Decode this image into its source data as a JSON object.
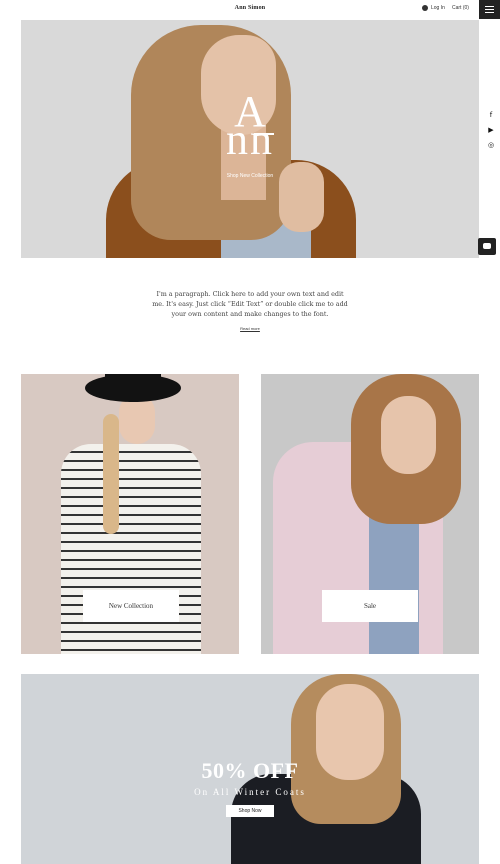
{
  "header": {
    "site_title": "Ann Simon",
    "login_label": "Log In",
    "cart_label": "Cart (0)"
  },
  "icons": {
    "menu": "hamburger-icon",
    "user": "user-icon",
    "facebook": "facebook-icon",
    "youtube": "youtube-icon",
    "instagram": "instagram-icon",
    "chat": "chat-icon"
  },
  "social": {
    "facebook_glyph": "f",
    "youtube_glyph": "▶",
    "instagram_glyph": "◎"
  },
  "hero": {
    "logo_line1": "A",
    "logo_line2": "nn",
    "cta": "Shop New Collection"
  },
  "intro": {
    "paragraph": "I'm a paragraph. Click here to add your own text and edit me. It's easy. Just click “Edit Text” or double click me to add your own content and make changes to the font.",
    "read_more": "Read more"
  },
  "tiles": {
    "left_button": "New Collection",
    "right_button": "Sale"
  },
  "promo": {
    "title": "50% OFF",
    "subtitle": "On All Winter Coats",
    "button": "Shop Now"
  },
  "colors": {
    "header_bg": "#ffffff",
    "menu_bg": "#222222",
    "hero_bg": "#d9d9d9",
    "promo_bg": "#d0d4d8"
  }
}
